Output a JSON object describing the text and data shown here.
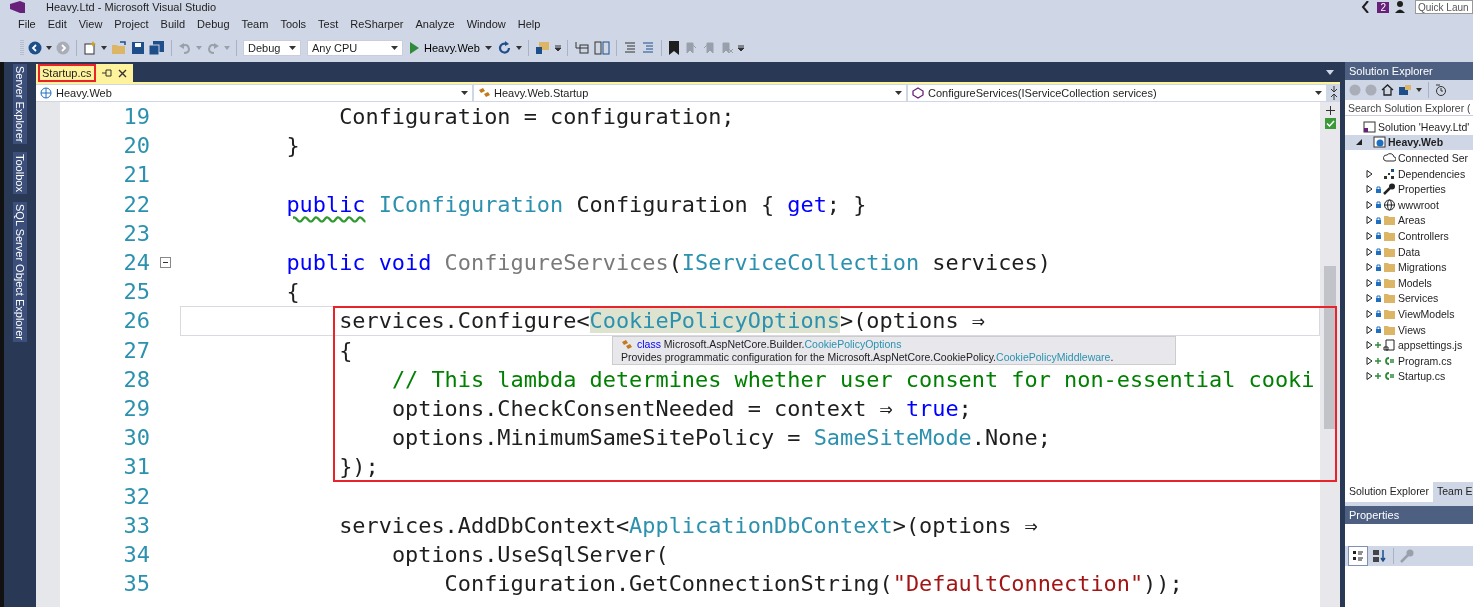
{
  "window": {
    "title": "Heavy.Ltd - Microsoft Visual Studio",
    "notification_count": "2",
    "quick_launch": {
      "placeholder": "Quick Laun"
    }
  },
  "menu": [
    "File",
    "Edit",
    "View",
    "Project",
    "Build",
    "Debug",
    "Team",
    "Tools",
    "Test",
    "ReSharper",
    "Analyze",
    "Window",
    "Help"
  ],
  "toolbar": {
    "configuration": "Debug",
    "platform": "Any CPU",
    "start": "Heavy.Web"
  },
  "side_tabs": [
    "Server Explorer",
    "Toolbox",
    "SQL Server Object Explorer"
  ],
  "editor_tabs": [
    {
      "label": "Startup.cs",
      "selected": true,
      "annotated": true
    }
  ],
  "navigation": {
    "project": "Heavy.Web",
    "type": "Heavy.Web.Startup",
    "member": "ConfigureServices(IServiceCollection services)"
  },
  "code": [
    {
      "number": "19",
      "segments": [
        {
          "text": "            Configuration = configuration;",
          "kind": "plain"
        }
      ]
    },
    {
      "number": "20",
      "segments": [
        {
          "text": "        }",
          "kind": "plain"
        }
      ]
    },
    {
      "number": "21"
    },
    {
      "number": "22",
      "segments": [
        {
          "text": "        public",
          "kind": "keyword",
          "squiggle": true
        },
        {
          "text": " IConfiguration",
          "kind": "type"
        },
        {
          "text": " Configuration { ",
          "kind": "plain"
        },
        {
          "text": "get",
          "kind": "keyword"
        },
        {
          "text": "; }",
          "kind": "plain"
        }
      ]
    },
    {
      "number": "23"
    },
    {
      "number": "24",
      "fold": true,
      "segments": [
        {
          "text": "        public void",
          "kind": "keyword"
        },
        {
          "text": " ConfigureServices",
          "kind": "dim"
        },
        {
          "text": "(",
          "kind": "plain"
        },
        {
          "text": "IServiceCollection",
          "kind": "type"
        },
        {
          "text": " services)",
          "kind": "plain"
        }
      ]
    },
    {
      "number": "25",
      "segments": [
        {
          "text": "        {",
          "kind": "plain"
        }
      ]
    },
    {
      "number": "26",
      "current": true,
      "boxed": true,
      "segments": [
        {
          "text": "            services.Configure<",
          "kind": "plain"
        },
        {
          "text": "CookiePolicyOptions",
          "kind": "type",
          "highlight": true
        },
        {
          "text": ">(options ⇒",
          "kind": "plain"
        }
      ]
    },
    {
      "number": "27",
      "boxed": true,
      "segments": [
        {
          "text": "            {",
          "kind": "plain"
        }
      ]
    },
    {
      "number": "28",
      "boxed": true,
      "segments": [
        {
          "text": "                // This lambda determines whether user consent for non-essential cooki",
          "kind": "comment"
        }
      ]
    },
    {
      "number": "29",
      "boxed": true,
      "segments": [
        {
          "text": "                options.CheckConsentNeeded = context ⇒ ",
          "kind": "plain"
        },
        {
          "text": "true",
          "kind": "keyword"
        },
        {
          "text": ";",
          "kind": "plain"
        }
      ]
    },
    {
      "number": "30",
      "boxed": true,
      "segments": [
        {
          "text": "                options.MinimumSameSitePolicy = ",
          "kind": "plain"
        },
        {
          "text": "SameSiteMode",
          "kind": "type"
        },
        {
          "text": ".None;",
          "kind": "plain"
        }
      ]
    },
    {
      "number": "31",
      "boxed": true,
      "segments": [
        {
          "text": "            });",
          "kind": "plain"
        }
      ]
    },
    {
      "number": "32"
    },
    {
      "number": "33",
      "segments": [
        {
          "text": "            services.AddDbContext<",
          "kind": "plain"
        },
        {
          "text": "ApplicationDbContext",
          "kind": "type"
        },
        {
          "text": ">(options ⇒",
          "kind": "plain"
        }
      ]
    },
    {
      "number": "34",
      "segments": [
        {
          "text": "                options.UseSqlServer(",
          "kind": "plain"
        }
      ]
    },
    {
      "number": "35",
      "segments": [
        {
          "text": "                    Configuration.GetConnectionString(",
          "kind": "plain"
        },
        {
          "text": "\"DefaultConnection\"",
          "kind": "string"
        },
        {
          "text": "));",
          "kind": "plain"
        }
      ]
    }
  ],
  "tooltip": {
    "signature": [
      {
        "text": "class",
        "kind": "keyword"
      },
      {
        "text": " Microsoft.AspNetCore.Builder.",
        "kind": "plain"
      },
      {
        "text": "CookiePolicyOptions",
        "kind": "type"
      }
    ],
    "description": [
      {
        "text": "Provides programmatic configuration for the Microsoft.AspNetCore.CookiePolicy.",
        "kind": "plain"
      },
      {
        "text": "CookiePolicyMiddleware",
        "kind": "type"
      },
      {
        "text": ".",
        "kind": "plain"
      }
    ]
  },
  "solution_explorer": {
    "title": "Solution Explorer",
    "search": {
      "placeholder": "Search Solution Explorer ("
    },
    "tree": [
      {
        "label": "Solution 'Heavy.Ltd'",
        "kind": "solution",
        "selected": false,
        "children": [
          {
            "label": "Heavy.Web",
            "kind": "project",
            "expanded": true,
            "selected": true,
            "children": [
              {
                "label": "Connected Ser",
                "kind": "connected",
                "selected": false,
                "locked": false,
                "added": false
              },
              {
                "label": "Dependencies",
                "kind": "dependencies",
                "expanded": false,
                "selected": false,
                "locked": false,
                "added": false
              },
              {
                "label": "Properties",
                "kind": "properties",
                "expanded": false,
                "selected": false,
                "locked": true,
                "added": false
              },
              {
                "label": "wwwroot",
                "kind": "web",
                "expanded": false,
                "selected": false,
                "locked": true,
                "added": false
              },
              {
                "label": "Areas",
                "kind": "folder",
                "expanded": false,
                "selected": false,
                "locked": true,
                "added": false
              },
              {
                "label": "Controllers",
                "kind": "folder",
                "expanded": false,
                "selected": false,
                "locked": true,
                "added": false
              },
              {
                "label": "Data",
                "kind": "folder",
                "expanded": false,
                "selected": false,
                "locked": true,
                "added": false
              },
              {
                "label": "Migrations",
                "kind": "folder",
                "expanded": false,
                "selected": false,
                "locked": true,
                "added": false
              },
              {
                "label": "Models",
                "kind": "folder",
                "expanded": false,
                "selected": false,
                "locked": true,
                "added": false
              },
              {
                "label": "Services",
                "kind": "folder",
                "expanded": false,
                "selected": false,
                "locked": true,
                "added": false
              },
              {
                "label": "ViewModels",
                "kind": "folder",
                "expanded": false,
                "selected": false,
                "locked": true,
                "added": false
              },
              {
                "label": "Views",
                "kind": "folder",
                "expanded": false,
                "selected": false,
                "locked": true,
                "added": false
              },
              {
                "label": "appsettings.js",
                "kind": "json",
                "expanded": false,
                "selected": false,
                "locked": false,
                "added": true
              },
              {
                "label": "Program.cs",
                "kind": "csharp",
                "expanded": false,
                "selected": false,
                "locked": false,
                "added": true
              },
              {
                "label": "Startup.cs",
                "kind": "csharp",
                "expanded": false,
                "selected": false,
                "locked": false,
                "added": true
              }
            ]
          }
        ]
      }
    ],
    "tabs": [
      {
        "label": "Solution Explorer",
        "selected": true
      },
      {
        "label": "Team E",
        "selected": false
      }
    ]
  },
  "properties": {
    "title": "Properties",
    "categorized": true
  }
}
